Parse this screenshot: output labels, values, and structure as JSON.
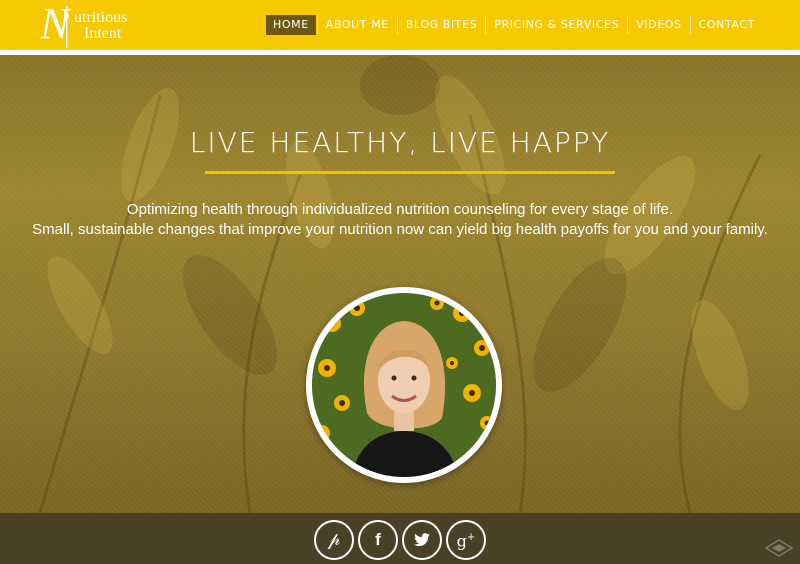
{
  "brand": {
    "logo_initial": "N",
    "logo_line1": "utritious",
    "logo_line2": "Intent"
  },
  "nav": {
    "items": [
      {
        "label": "HOME",
        "active": true
      },
      {
        "label": "ABOUT ME",
        "active": false
      },
      {
        "label": "BLOG BITES",
        "active": false
      },
      {
        "label": "PRICING & SERVICES",
        "active": false
      },
      {
        "label": "VIDEOS",
        "active": false
      },
      {
        "label": "CONTACT",
        "active": false
      }
    ]
  },
  "hero": {
    "title": "LIVE HEALTHY, LIVE HAPPY",
    "line1": "Optimizing health through individualized nutrition counseling for every stage of life.",
    "line2": "Small, sustainable changes that improve your nutrition now can yield big health payoffs for you and your family."
  },
  "social": [
    {
      "name": "pinterest-icon",
      "glyph": "p"
    },
    {
      "name": "facebook-icon",
      "glyph": "f"
    },
    {
      "name": "twitter-icon",
      "glyph": "twitter-bird"
    },
    {
      "name": "google-plus-icon",
      "glyph": "g+"
    }
  ],
  "colors": {
    "header": "#f7c900",
    "accent_rule": "#f2c200",
    "active_nav": "#6e5712",
    "footer": "#4a3f27"
  }
}
